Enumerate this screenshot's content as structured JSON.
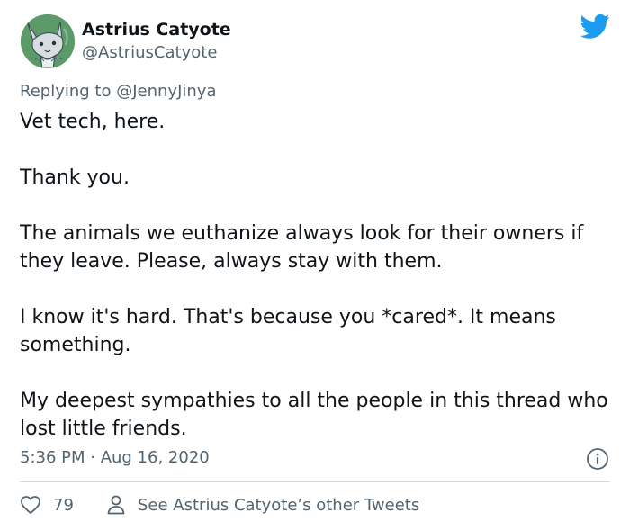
{
  "author": {
    "display_name": "Astrius Catyote",
    "handle": "@AstriusCatyote",
    "avatar_icon": "fox-character-avatar"
  },
  "reply": {
    "prefix": "Replying to",
    "mention": "@JennyJinya"
  },
  "tweet": {
    "paragraphs": [
      "Vet tech, here.",
      "Thank you.",
      "The animals we euthanize always look for their owners if they leave. Please, always stay with them.",
      "I know it's hard. That's because you *cared*. It means something.",
      "My deepest sympathies to all the people in this thread who lost little friends."
    ]
  },
  "meta": {
    "timestamp": "5:36 PM · Aug 16, 2020"
  },
  "actions": {
    "like_count": "79",
    "others_label": "See Astrius Catyote’s other Tweets"
  },
  "colors": {
    "twitter_blue": "#1d9bf0",
    "secondary_text": "#536471",
    "divider": "#cfd9de",
    "avatar_bg": "#5d9a6a"
  }
}
